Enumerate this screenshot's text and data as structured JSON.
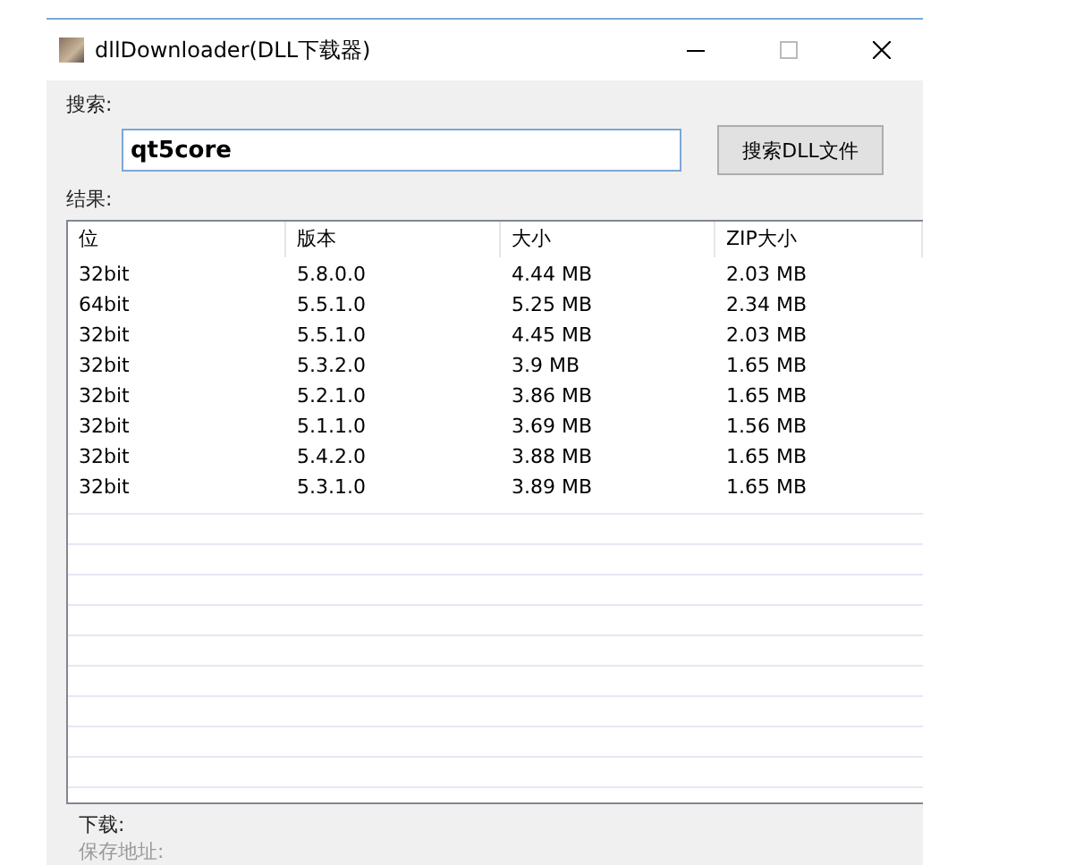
{
  "window": {
    "title": "dllDownloader(DLL下载器)"
  },
  "search": {
    "label": "搜索:",
    "value": "qt5core",
    "button": "搜索DLL文件"
  },
  "results": {
    "label": "结果:",
    "columns": [
      "位",
      "版本",
      "大小",
      "ZIP大小"
    ],
    "rows": [
      [
        "32bit",
        "5.8.0.0",
        "4.44 MB",
        "2.03 MB"
      ],
      [
        "64bit",
        "5.5.1.0",
        "5.25 MB",
        "2.34 MB"
      ],
      [
        "32bit",
        "5.5.1.0",
        "4.45 MB",
        "2.03 MB"
      ],
      [
        "32bit",
        "5.3.2.0",
        "3.9 MB",
        "1.65 MB"
      ],
      [
        "32bit",
        "5.2.1.0",
        "3.86 MB",
        "1.65 MB"
      ],
      [
        "32bit",
        "5.1.1.0",
        "3.69 MB",
        "1.56 MB"
      ],
      [
        "32bit",
        "5.4.2.0",
        "3.88 MB",
        "1.65 MB"
      ],
      [
        "32bit",
        "5.3.1.0",
        "3.89 MB",
        "1.65 MB"
      ]
    ]
  },
  "download": {
    "label": "下载:",
    "save_label": "保存地址:"
  }
}
